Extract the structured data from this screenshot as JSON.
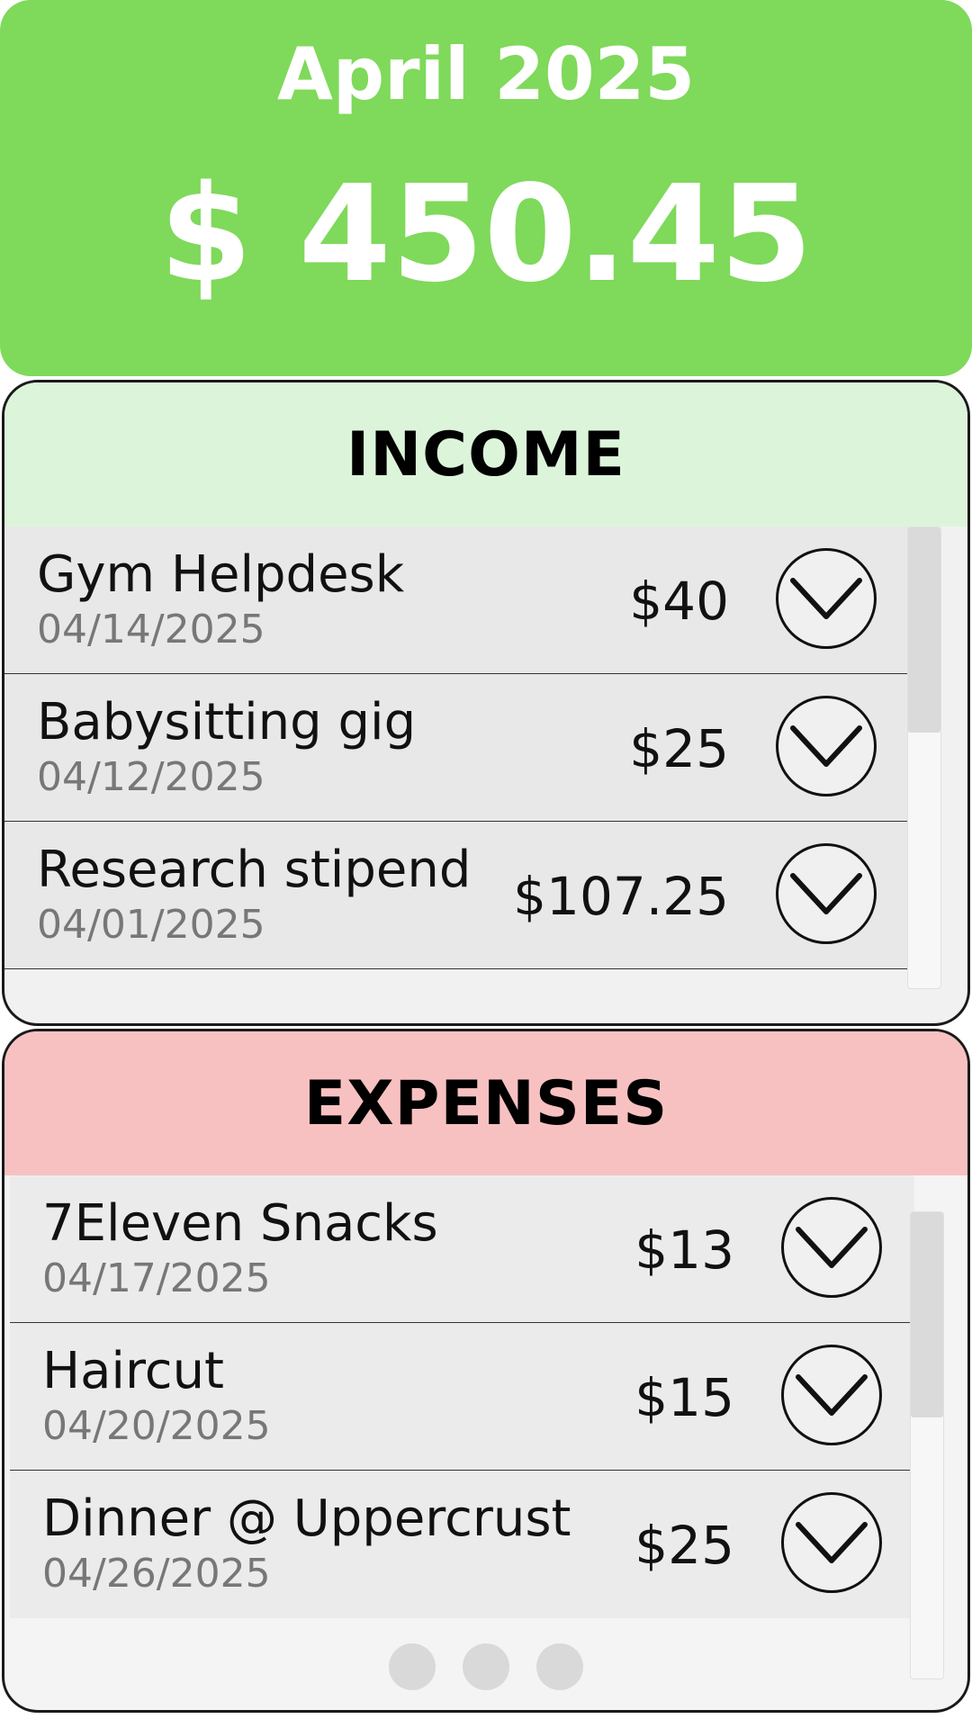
{
  "header": {
    "month": "April 2025",
    "total": "$ 450.45"
  },
  "income": {
    "title": "INCOME",
    "items": [
      {
        "name": "Gym Helpdesk",
        "date": "04/14/2025",
        "amount": "$40"
      },
      {
        "name": "Babysitting gig",
        "date": "04/12/2025",
        "amount": "$25"
      },
      {
        "name": "Research stipend",
        "date": "04/01/2025",
        "amount": "$107.25"
      }
    ]
  },
  "expenses": {
    "title": "EXPENSES",
    "items": [
      {
        "name": "7Eleven Snacks",
        "date": "04/17/2025",
        "amount": "$13"
      },
      {
        "name": "Haircut",
        "date": "04/20/2025",
        "amount": "$15"
      },
      {
        "name": "Dinner @ Uppercrust",
        "date": "04/26/2025",
        "amount": "$25"
      }
    ]
  },
  "icons": {
    "row_toggle": "chevron-down-icon"
  },
  "colors": {
    "header_bg": "#7fd95b",
    "income_head_bg": "#dcf5da",
    "expenses_head_bg": "#f8c1c1"
  }
}
